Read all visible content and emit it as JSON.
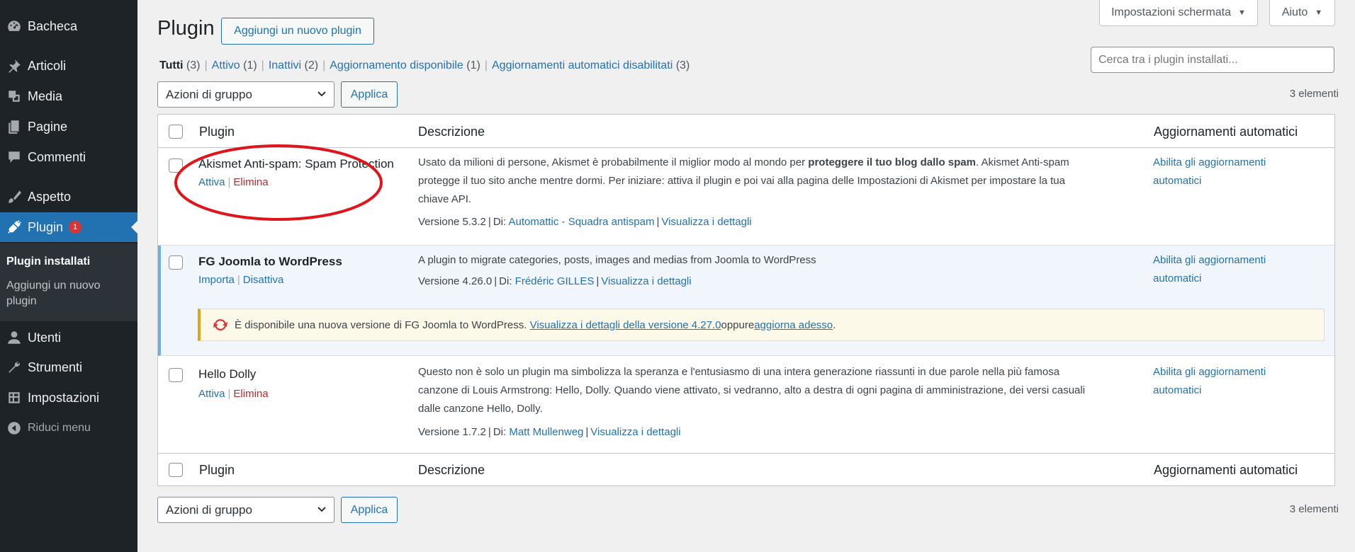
{
  "sidebar": {
    "items": [
      {
        "label": "Bacheca",
        "icon": "dashboard-icon"
      },
      {
        "label": "Articoli",
        "icon": "pin-icon"
      },
      {
        "label": "Media",
        "icon": "media-icon"
      },
      {
        "label": "Pagine",
        "icon": "pages-icon"
      },
      {
        "label": "Commenti",
        "icon": "comments-icon"
      },
      {
        "label": "Aspetto",
        "icon": "paintbrush-icon"
      },
      {
        "label": "Plugin",
        "icon": "plugins-icon",
        "badge": "1"
      },
      {
        "label": "Utenti",
        "icon": "users-icon"
      },
      {
        "label": "Strumenti",
        "icon": "tools-icon"
      },
      {
        "label": "Impostazioni",
        "icon": "settings-icon"
      },
      {
        "label": "Riduci menu",
        "icon": "collapse-icon"
      }
    ],
    "submenu": {
      "installed": "Plugin installati",
      "add_new": "Aggiungi un nuovo plugin"
    }
  },
  "header": {
    "title": "Plugin",
    "add_new_button": "Aggiungi un nuovo plugin",
    "screen_options": "Impostazioni schermata",
    "help": "Aiuto"
  },
  "filters": [
    {
      "label": "Tutti",
      "count": "(3)"
    },
    {
      "label": "Attivo",
      "count": "(1)"
    },
    {
      "label": "Inattivi",
      "count": "(2)"
    },
    {
      "label": "Aggiornamento disponibile",
      "count": "(1)"
    },
    {
      "label": "Aggiornamenti automatici disabilitati",
      "count": "(3)"
    }
  ],
  "search": {
    "placeholder": "Cerca tra i plugin installati..."
  },
  "bulk": {
    "select": "Azioni di gruppo",
    "apply": "Applica",
    "count": "3 elementi"
  },
  "columns": {
    "plugin": "Plugin",
    "description": "Descrizione",
    "auto": "Aggiornamenti automatici"
  },
  "plugins": [
    {
      "name": "Akismet Anti-spam: Spam Protection",
      "action1": "Attiva",
      "action2": "Elimina",
      "desc_pre": "Usato da milioni di persone, Akismet è probabilmente il miglior modo al mondo per ",
      "desc_bold": "proteggere il tuo blog dallo spam",
      "desc_line1_post": ". Akismet Anti-spam",
      "desc_line2": "protegge il tuo sito anche mentre dormi. Per iniziare: attiva il plugin e poi vai alla pagina delle Impostazioni di Akismet per impostare la tua",
      "desc_line3": "chiave API.",
      "version": "Versione 5.3.2",
      "by": "Di:",
      "author": "Automattic - Squadra antispam",
      "details": "Visualizza i dettagli",
      "auto": "Abilita gli aggiornamenti",
      "auto2": "automatici"
    },
    {
      "name": "FG Joomla to WordPress",
      "action1": "Importa",
      "action2": "Disattiva",
      "desc": "A plugin to migrate categories, posts, images and medias from Joomla to WordPress",
      "version": "Versione 4.26.0",
      "by": "Di:",
      "author": "Frédéric GILLES",
      "details": "Visualizza i dettagli",
      "auto": "Abilita gli aggiornamenti",
      "auto2": "automatici",
      "notice_pre": "È disponibile una nuova versione di FG Joomla to WordPress. ",
      "notice_link1": "Visualizza i dettagli della versione 4.27.0",
      "notice_mid": " oppure ",
      "notice_link2": "aggiorna adesso",
      "notice_post": "."
    },
    {
      "name": "Hello Dolly",
      "action1": "Attiva",
      "action2": "Elimina",
      "desc_line1": "Questo non è solo un plugin ma simbolizza la speranza e l'entusiasmo di una intera generazione riassunti in due parole nella più famosa",
      "desc_line2": "canzone di Louis Armstrong: Hello, Dolly. Quando viene attivato, si vedranno, alto a destra di ogni pagina di amministrazione, dei versi casuali",
      "desc_line3": "dalle canzone Hello, Dolly.",
      "version": "Versione 1.7.2",
      "by": "Di:",
      "author": "Matt Mullenweg",
      "details": "Visualizza i dettagli",
      "auto": "Abilita gli aggiornamenti",
      "auto2": "automatici"
    }
  ],
  "colors": {
    "sidebar": "#1d2327",
    "accent": "#2271b1",
    "delete": "#b32d2e",
    "annotation": "#e0141b"
  }
}
